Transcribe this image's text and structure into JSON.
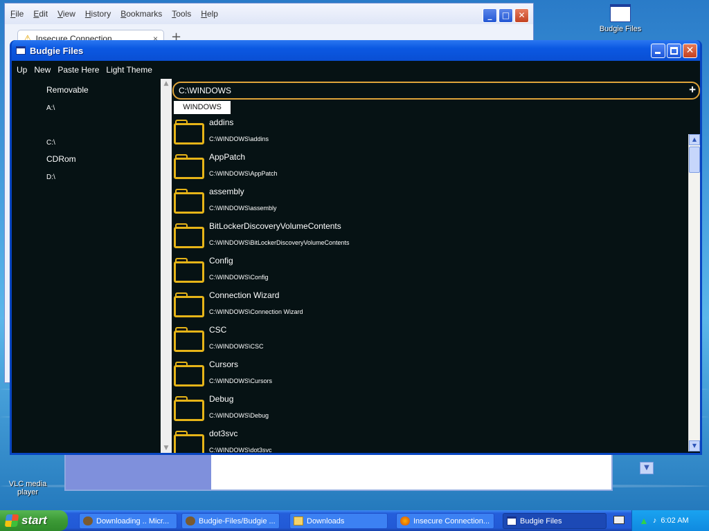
{
  "desktop": {
    "icons": [
      {
        "label": "Budgie Files"
      },
      {
        "label": "VLC media player"
      }
    ]
  },
  "browser": {
    "menu": [
      "File",
      "Edit",
      "View",
      "History",
      "Bookmarks",
      "Tools",
      "Help"
    ],
    "tab_title": "Insecure Connection",
    "tab_close": "×",
    "new_tab": "+"
  },
  "window": {
    "title": "Budgie Files",
    "minimize": "",
    "maximize": "",
    "close": "✕"
  },
  "toolbar": {
    "up": "Up",
    "new": "New",
    "paste": "Paste Here",
    "theme": "Light Theme"
  },
  "sidebar": {
    "groups": [
      {
        "label": "Removable"
      },
      {
        "label": "A:\\"
      },
      {
        "label": "C:\\"
      },
      {
        "label": "CDRom"
      },
      {
        "label": "D:\\"
      }
    ]
  },
  "path_input": {
    "value": "C:\\WINDOWS",
    "add": "+"
  },
  "breadcrumb": {
    "current": "WINDOWS"
  },
  "files": [
    {
      "name": "addins",
      "path": "C:\\WINDOWS\\addins",
      "dash": "-"
    },
    {
      "name": "AppPatch",
      "path": "C:\\WINDOWS\\AppPatch",
      "dash": "-"
    },
    {
      "name": "assembly",
      "path": "C:\\WINDOWS\\assembly",
      "dash": "-"
    },
    {
      "name": "BitLockerDiscoveryVolumeContents",
      "path": "C:\\WINDOWS\\BitLockerDiscoveryVolumeContents",
      "dash": "-"
    },
    {
      "name": "Config",
      "path": "C:\\WINDOWS\\Config",
      "dash": "-"
    },
    {
      "name": "Connection Wizard",
      "path": "C:\\WINDOWS\\Connection Wizard",
      "dash": "-"
    },
    {
      "name": "CSC",
      "path": "C:\\WINDOWS\\CSC",
      "dash": "-"
    },
    {
      "name": "Cursors",
      "path": "C:\\WINDOWS\\Cursors",
      "dash": "-"
    },
    {
      "name": "Debug",
      "path": "C:\\WINDOWS\\Debug",
      "dash": "-"
    },
    {
      "name": "dot3svc",
      "path": "C:\\WINDOWS\\dot3svc",
      "dash": "-"
    }
  ],
  "taskbar": {
    "start": "start",
    "tasks": [
      {
        "label": "Downloading .. Micr..."
      },
      {
        "label": "Budgie-Files/Budgie ..."
      },
      {
        "label": "Downloads"
      },
      {
        "label": "Insecure Connection..."
      },
      {
        "label": "Budgie Files"
      }
    ],
    "clock": "6:02 AM"
  },
  "colors": {
    "accent_border": "#e0a43a",
    "folder": "#e6b418",
    "client_bg": "#061214"
  }
}
